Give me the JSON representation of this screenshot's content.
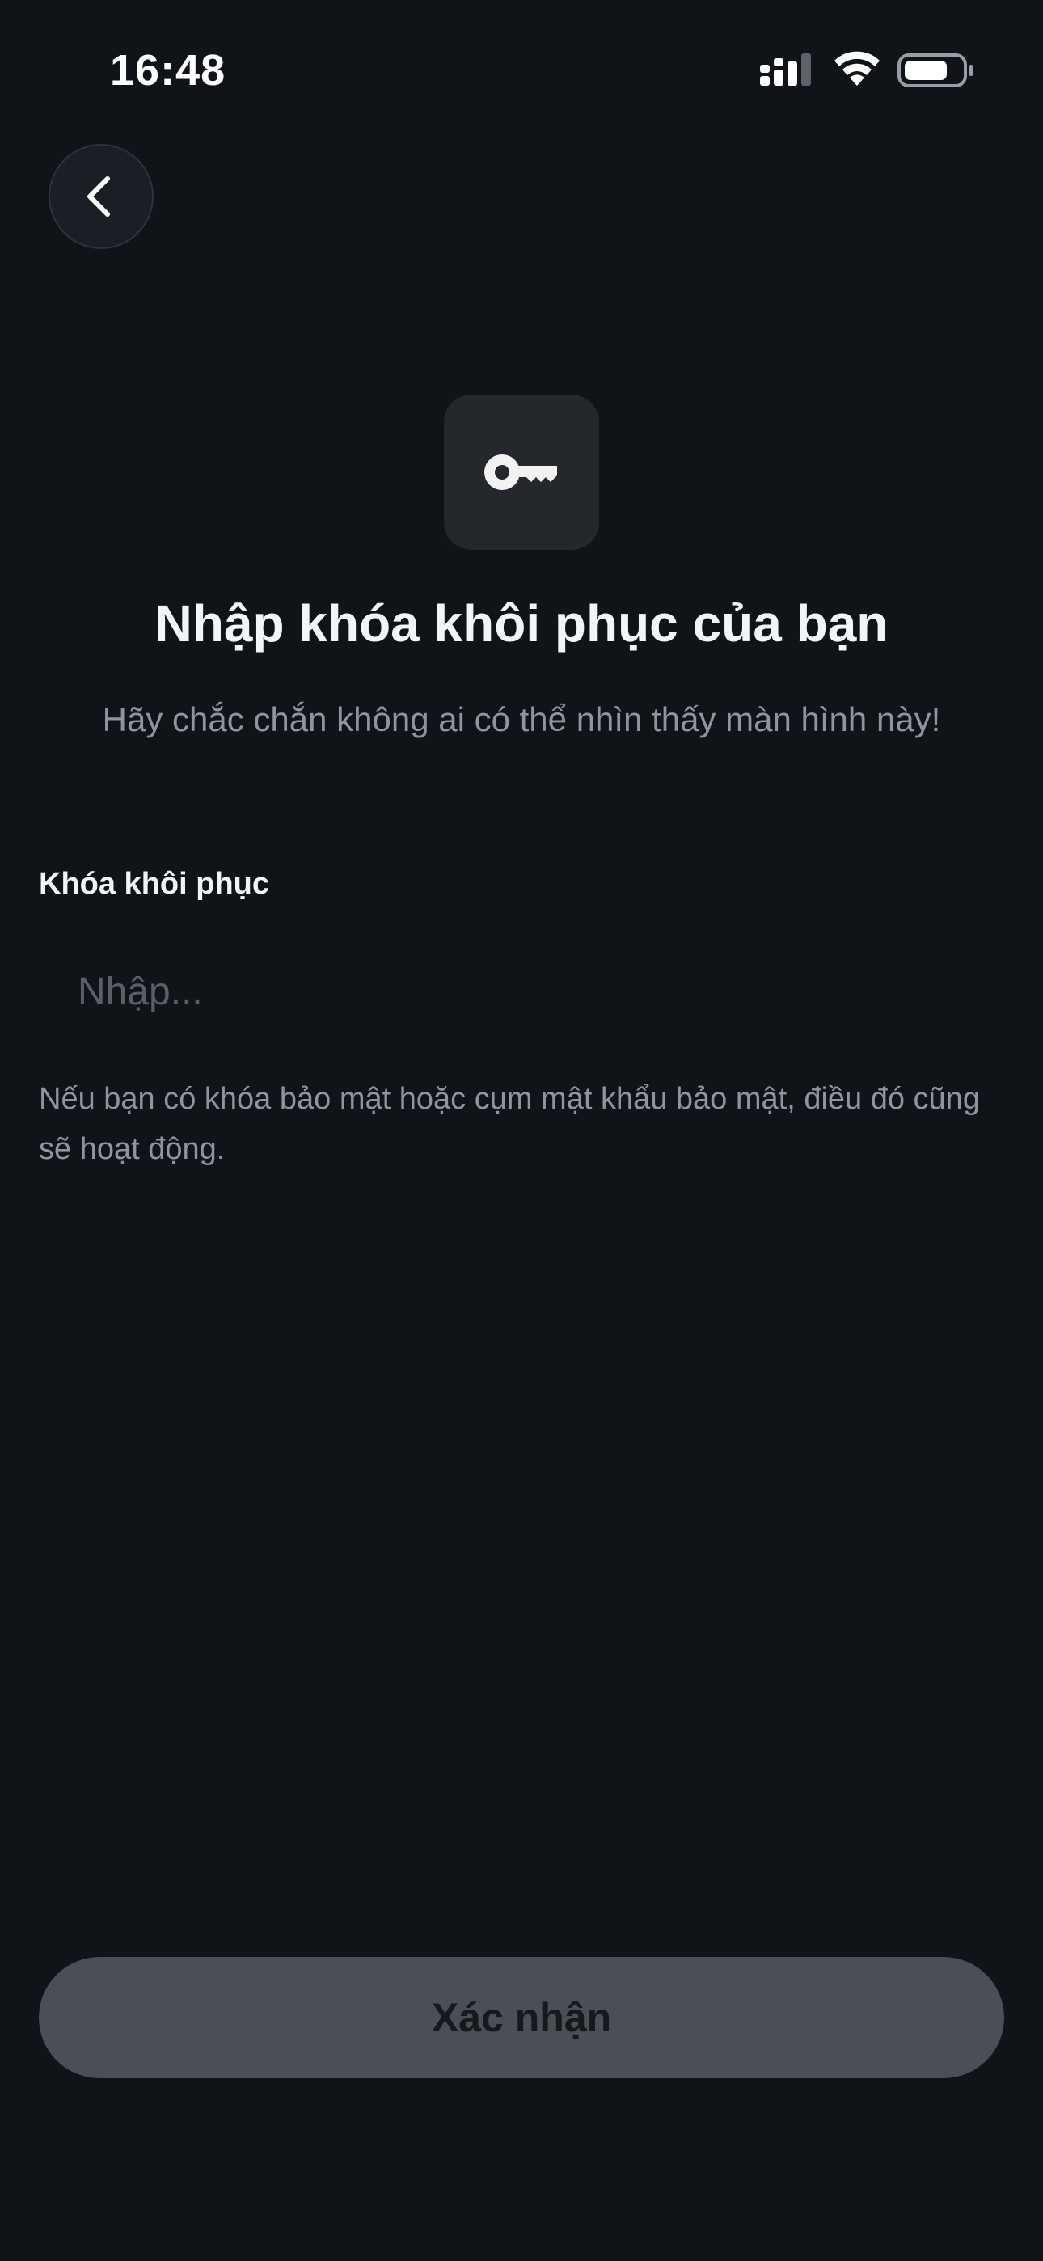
{
  "status_bar": {
    "time": "16:48",
    "icons": [
      "signal-icon",
      "wifi-icon",
      "battery-icon"
    ]
  },
  "navigation": {
    "back_icon": "chevron-left-icon"
  },
  "header": {
    "icon": "key-icon",
    "title": "Nhập khóa khôi phục của bạn",
    "subtitle": "Hãy chắc chắn không ai có thể nhìn thấy màn hình này!"
  },
  "form": {
    "label": "Khóa khôi phục",
    "input_value": "",
    "input_placeholder": "Nhập...",
    "helper": "Nếu bạn có khóa bảo mật hoặc cụm mật khẩu bảo mật, điều đó cũng sẽ hoạt động."
  },
  "actions": {
    "confirm_label": "Xác nhận"
  },
  "colors": {
    "background": "#101318",
    "tile": "#24272c",
    "muted_text": "#8f959d",
    "placeholder": "#5a5f66",
    "button_disabled": "#4a4e55"
  }
}
